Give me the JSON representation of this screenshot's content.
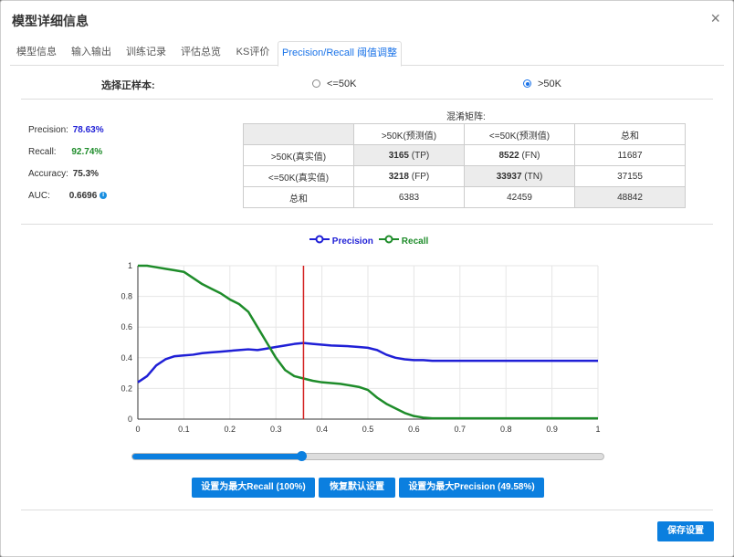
{
  "window": {
    "title": "模型详细信息"
  },
  "tabs": [
    "模型信息",
    "输入输出",
    "训练记录",
    "评估总览",
    "KS评价",
    "Precision/Recall 阈值调整"
  ],
  "positive": {
    "label": "选择正样本:",
    "options": [
      "<=50K",
      ">50K"
    ],
    "selected": ">50K"
  },
  "metrics": {
    "precision_label": "Precision:",
    "precision_value": "78.63%",
    "recall_label": "Recall:",
    "recall_value": "92.74%",
    "accuracy_label": "Accuracy:",
    "accuracy_value": "75.3%",
    "auc_label": "AUC:",
    "auc_value": "0.6696"
  },
  "confusion": {
    "title": "混淆矩阵:",
    "header": [
      "",
      ">50K(预测值)",
      "<=50K(预测值)",
      "总和"
    ],
    "rows": [
      [
        ">50K(真实值)",
        "3165",
        "(TP)",
        "8522",
        "(FN)",
        "11687"
      ],
      [
        "<=50K(真实值)",
        "3218",
        "(FP)",
        "33937",
        "(TN)",
        "37155"
      ],
      [
        "总和",
        "6383",
        "",
        "42459",
        "",
        "48842"
      ]
    ]
  },
  "chart_data": {
    "type": "line",
    "xlim": [
      0,
      1
    ],
    "ylim": [
      0,
      1
    ],
    "xticks": [
      "0",
      "0.1",
      "0.2",
      "0.3",
      "0.4",
      "0.5",
      "0.6",
      "0.7",
      "0.8",
      "0.9",
      "1"
    ],
    "yticks": [
      "0",
      "0.2",
      "0.4",
      "0.6",
      "0.8",
      "1"
    ],
    "grid": true,
    "legend": "top",
    "threshold": 0.36,
    "x": [
      0,
      0.02,
      0.04,
      0.06,
      0.08,
      0.1,
      0.12,
      0.14,
      0.16,
      0.18,
      0.2,
      0.22,
      0.24,
      0.26,
      0.28,
      0.3,
      0.32,
      0.34,
      0.36,
      0.38,
      0.4,
      0.42,
      0.44,
      0.46,
      0.48,
      0.5,
      0.52,
      0.54,
      0.56,
      0.58,
      0.6,
      0.62,
      0.64,
      0.7,
      0.8,
      0.9,
      1.0
    ],
    "series": [
      {
        "name": "Precision",
        "color": "#1f1fd6",
        "values": [
          0.24,
          0.28,
          0.35,
          0.39,
          0.41,
          0.415,
          0.42,
          0.43,
          0.435,
          0.44,
          0.445,
          0.45,
          0.455,
          0.45,
          0.46,
          0.47,
          0.48,
          0.49,
          0.496,
          0.49,
          0.485,
          0.48,
          0.478,
          0.475,
          0.47,
          0.465,
          0.45,
          0.42,
          0.4,
          0.39,
          0.385,
          0.385,
          0.38,
          0.38,
          0.38,
          0.38,
          0.38
        ]
      },
      {
        "name": "Recall",
        "color": "#1e8c2a",
        "values": [
          1.0,
          1.0,
          0.99,
          0.98,
          0.97,
          0.96,
          0.92,
          0.88,
          0.85,
          0.82,
          0.78,
          0.75,
          0.7,
          0.6,
          0.5,
          0.4,
          0.32,
          0.28,
          0.265,
          0.25,
          0.24,
          0.235,
          0.23,
          0.22,
          0.21,
          0.19,
          0.14,
          0.1,
          0.07,
          0.04,
          0.02,
          0.01,
          0.005,
          0.005,
          0.005,
          0.005,
          0.005
        ]
      }
    ]
  },
  "slider": {
    "value": 0.36
  },
  "buttons": {
    "max_recall": "设置为最大Recall (100%)",
    "reset": "恢复默认设置",
    "max_precision": "设置为最大Precision (49.58%)",
    "save": "保存设置"
  }
}
